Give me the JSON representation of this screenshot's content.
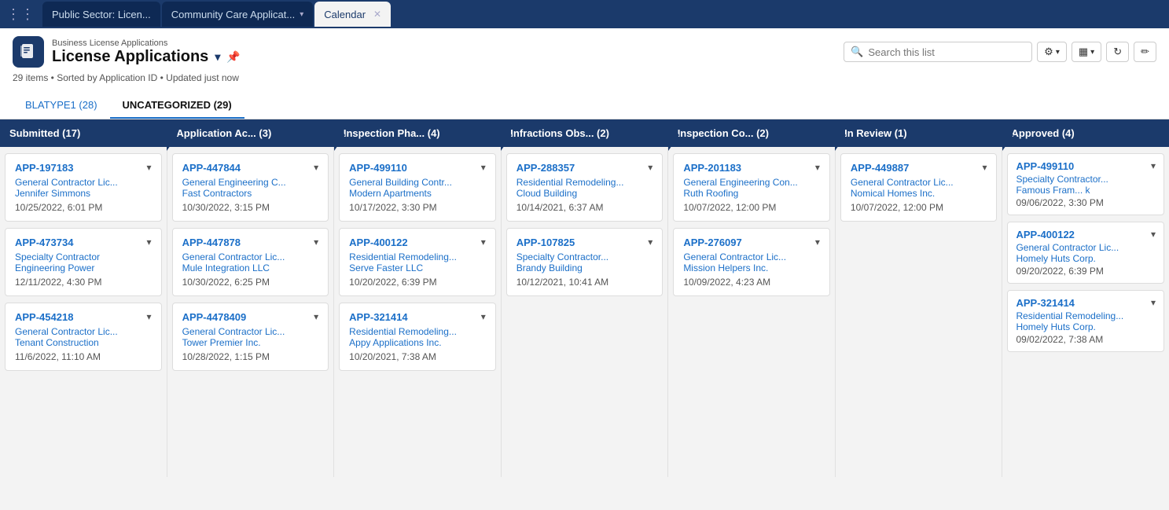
{
  "tabs": [
    {
      "label": "Public Sector: Licen...",
      "active": false,
      "hasChevron": false,
      "hasClose": false
    },
    {
      "label": "Community Care Applicat...",
      "active": false,
      "hasChevron": true,
      "hasClose": false
    },
    {
      "label": "Calendar",
      "active": true,
      "hasChevron": false,
      "hasClose": true
    }
  ],
  "breadcrumb": "Business License Applications",
  "pageTitle": "License Applications",
  "statusBar": "29 items • Sorted by Application ID • Updated just now",
  "search": {
    "placeholder": "Search this list"
  },
  "listTabs": [
    {
      "label": "BLATYPE1 (28)",
      "active": false
    },
    {
      "label": "UNCATEGORIZED (29)",
      "active": true
    }
  ],
  "columns": [
    {
      "header": "Submitted  (17)",
      "cards": [
        {
          "id": "APP-197183",
          "type": "General Contractor Lic...",
          "company": "Jennifer Simmons",
          "date": "10/25/2022, 6:01 PM"
        },
        {
          "id": "APP-473734",
          "type": "Specialty Contractor",
          "company": "Engineering Power",
          "date": "12/11/2022, 4:30 PM"
        },
        {
          "id": "APP-454218",
          "type": "General Contractor Lic...",
          "company": "Tenant Construction",
          "date": "11/6/2022, 11:10 AM"
        }
      ]
    },
    {
      "header": "Application Ac...  (3)",
      "cards": [
        {
          "id": "APP-447844",
          "type": "General Engineering C...",
          "company": "Fast Contractors",
          "date": "10/30/2022, 3:15 PM"
        },
        {
          "id": "APP-447878",
          "type": "General Contractor Lic...",
          "company": "Mule Integration LLC",
          "date": "10/30/2022, 6:25 PM"
        },
        {
          "id": "APP-4478409",
          "type": "General Contractor Lic...",
          "company": "Tower Premier Inc.",
          "date": "10/28/2022, 1:15 PM"
        }
      ]
    },
    {
      "header": "Inspection Pha...  (4)",
      "cards": [
        {
          "id": "APP-499110",
          "type": "General Building Contr...",
          "company": "Modern Apartments",
          "date": "10/17/2022, 3:30 PM"
        },
        {
          "id": "APP-400122",
          "type": "Residential Remodeling...",
          "company": "Serve Faster LLC",
          "date": "10/20/2022, 6:39 PM"
        },
        {
          "id": "APP-321414",
          "type": "Residential Remodeling...",
          "company": "Appy Applications Inc.",
          "date": "10/20/2021, 7:38 AM"
        }
      ]
    },
    {
      "header": "Infractions Obs...  (2)",
      "cards": [
        {
          "id": "APP-288357",
          "type": "Residential Remodeling...",
          "company": "Cloud Building",
          "date": "10/14/2021, 6:37 AM"
        },
        {
          "id": "APP-107825",
          "type": "Specialty Contractor...",
          "company": "Brandy Building",
          "date": "10/12/2021, 10:41 AM"
        }
      ]
    },
    {
      "header": "Inspection Co...  (2)",
      "cards": [
        {
          "id": "APP-201183",
          "type": "General Engineering Con...",
          "company": "Ruth Roofing",
          "date": "10/07/2022, 12:00 PM"
        },
        {
          "id": "APP-276097",
          "type": "General Contractor Lic...",
          "company": "Mission Helpers Inc.",
          "date": "10/09/2022, 4:23 AM"
        }
      ]
    },
    {
      "header": "In Review  (1)",
      "cards": [
        {
          "id": "APP-449887",
          "type": "General Contractor Lic...",
          "company": "Nomical Homes Inc.",
          "date": "10/07/2022, 12:00 PM"
        }
      ]
    },
    {
      "header": "Approved  (4)",
      "cards": [
        {
          "id": "APP-499110",
          "type": "Specialty Contractor...",
          "company": "Famous Fram...  k",
          "date": "09/06/2022, 3:30 PM"
        },
        {
          "id": "APP-400122",
          "type": "General Contractor Lic...",
          "company": "Homely Huts Corp.",
          "date": "09/20/2022, 6:39 PM"
        },
        {
          "id": "APP-321414",
          "type": "Residential Remodeling...",
          "company": "Homely Huts Corp.",
          "date": "09/02/2022, 7:38 AM"
        }
      ]
    }
  ]
}
